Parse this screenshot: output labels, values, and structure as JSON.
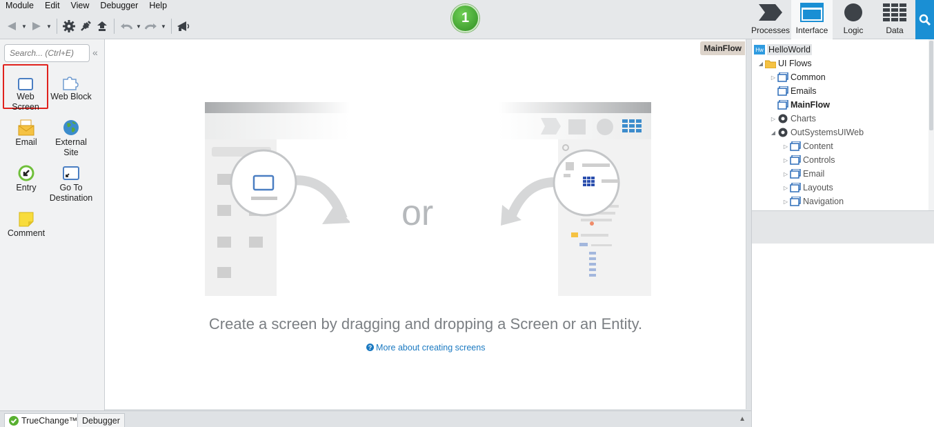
{
  "menu": [
    "Module",
    "Edit",
    "View",
    "Debugger",
    "Help"
  ],
  "step_badge": "1",
  "right_tabs": [
    {
      "label": "Processes",
      "icon": "processes-icon"
    },
    {
      "label": "Interface",
      "icon": "interface-icon",
      "active": true
    },
    {
      "label": "Logic",
      "icon": "logic-icon"
    },
    {
      "label": "Data",
      "icon": "data-icon"
    }
  ],
  "toolbox": {
    "search_placeholder": "Search... (Ctrl+E)",
    "tools": [
      {
        "label": "Web Screen",
        "icon": "web-screen-icon",
        "selected": true
      },
      {
        "label": "Web Block",
        "icon": "web-block-icon"
      },
      {
        "label": "Email",
        "icon": "email-icon"
      },
      {
        "label": "External Site",
        "icon": "external-site-icon"
      },
      {
        "label": "Entry",
        "icon": "entry-icon"
      },
      {
        "label": "Go To Destination",
        "icon": "go-to-destination-icon"
      },
      {
        "label": "Comment",
        "icon": "comment-icon"
      }
    ]
  },
  "canvas": {
    "flow_tag": "MainFlow",
    "or_text": "or",
    "hint": "Create a screen by dragging and dropping a Screen or an Entity.",
    "more_link": "More about creating screens"
  },
  "tree": [
    {
      "label": "HelloWorld",
      "level": 0,
      "icon": "module-icon",
      "arrow": ""
    },
    {
      "label": "UI Flows",
      "level": 1,
      "icon": "folder-icon",
      "arrow": "expanded"
    },
    {
      "label": "Common",
      "level": 2,
      "icon": "flow-icon",
      "arrow": "collapsed"
    },
    {
      "label": "Emails",
      "level": 2,
      "icon": "flow-icon",
      "arrow": ""
    },
    {
      "label": "MainFlow",
      "level": 2,
      "icon": "flow-icon",
      "arrow": "",
      "bold": true
    },
    {
      "label": "Charts",
      "level": 2,
      "icon": "dependency-icon",
      "arrow": "collapsed"
    },
    {
      "label": "OutSystemsUIWeb",
      "level": 2,
      "icon": "dependency-icon",
      "arrow": "expanded"
    },
    {
      "label": "Content",
      "level": 3,
      "icon": "flow-icon",
      "arrow": "collapsed"
    },
    {
      "label": "Controls",
      "level": 3,
      "icon": "flow-icon",
      "arrow": "collapsed"
    },
    {
      "label": "Email",
      "level": 3,
      "icon": "flow-icon",
      "arrow": "collapsed"
    },
    {
      "label": "Layouts",
      "level": 3,
      "icon": "flow-icon",
      "arrow": "collapsed"
    },
    {
      "label": "Navigation",
      "level": 3,
      "icon": "flow-icon",
      "arrow": "collapsed"
    }
  ],
  "bottom_tabs": [
    "TrueChange™",
    "Debugger"
  ]
}
